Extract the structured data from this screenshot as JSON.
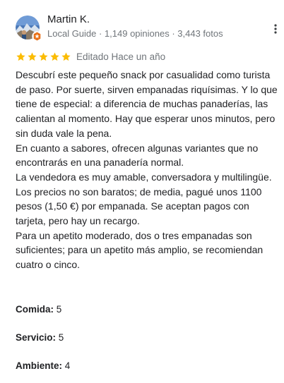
{
  "author": {
    "name": "Martin K.",
    "meta": "Local Guide · 1,149 opiniones · 3,443 fotos",
    "avatar_icon": "avatar-photo",
    "badge_icon": "local-guide-badge-icon",
    "badge_color": "#e8711a"
  },
  "menu": {
    "icon": "more-vert-icon"
  },
  "rating": {
    "stars": 5,
    "max_stars": 5,
    "star_color": "#fbbc04",
    "edited_label": "Editado Hace un año"
  },
  "review": {
    "paragraphs": [
      "Descubrí este pequeño snack por casualidad como turista de paso. Por suerte, sirven empanadas riquísimas. Y lo que tiene de especial: a diferencia de muchas panaderías, las calientan al momento. Hay que esperar unos minutos, pero sin duda vale la pena.",
      "En cuanto a sabores, ofrecen algunas variantes que no encontrarás en una panadería normal.",
      "La vendedora es muy amable, conversadora y multilingüe.",
      "Los precios no son baratos; de media, pagué unos 1100 pesos (1,50 €) por empanada. Se aceptan pagos con tarjeta, pero hay un recargo.",
      "Para un apetito moderado, dos o tres empanadas son suficientes; para un apetito más amplio, se recomiendan cuatro o cinco."
    ]
  },
  "aspects": [
    {
      "label": "Comida:",
      "value": "5"
    },
    {
      "label": "Servicio:",
      "value": "5"
    },
    {
      "label": "Ambiente:",
      "value": "4"
    }
  ]
}
